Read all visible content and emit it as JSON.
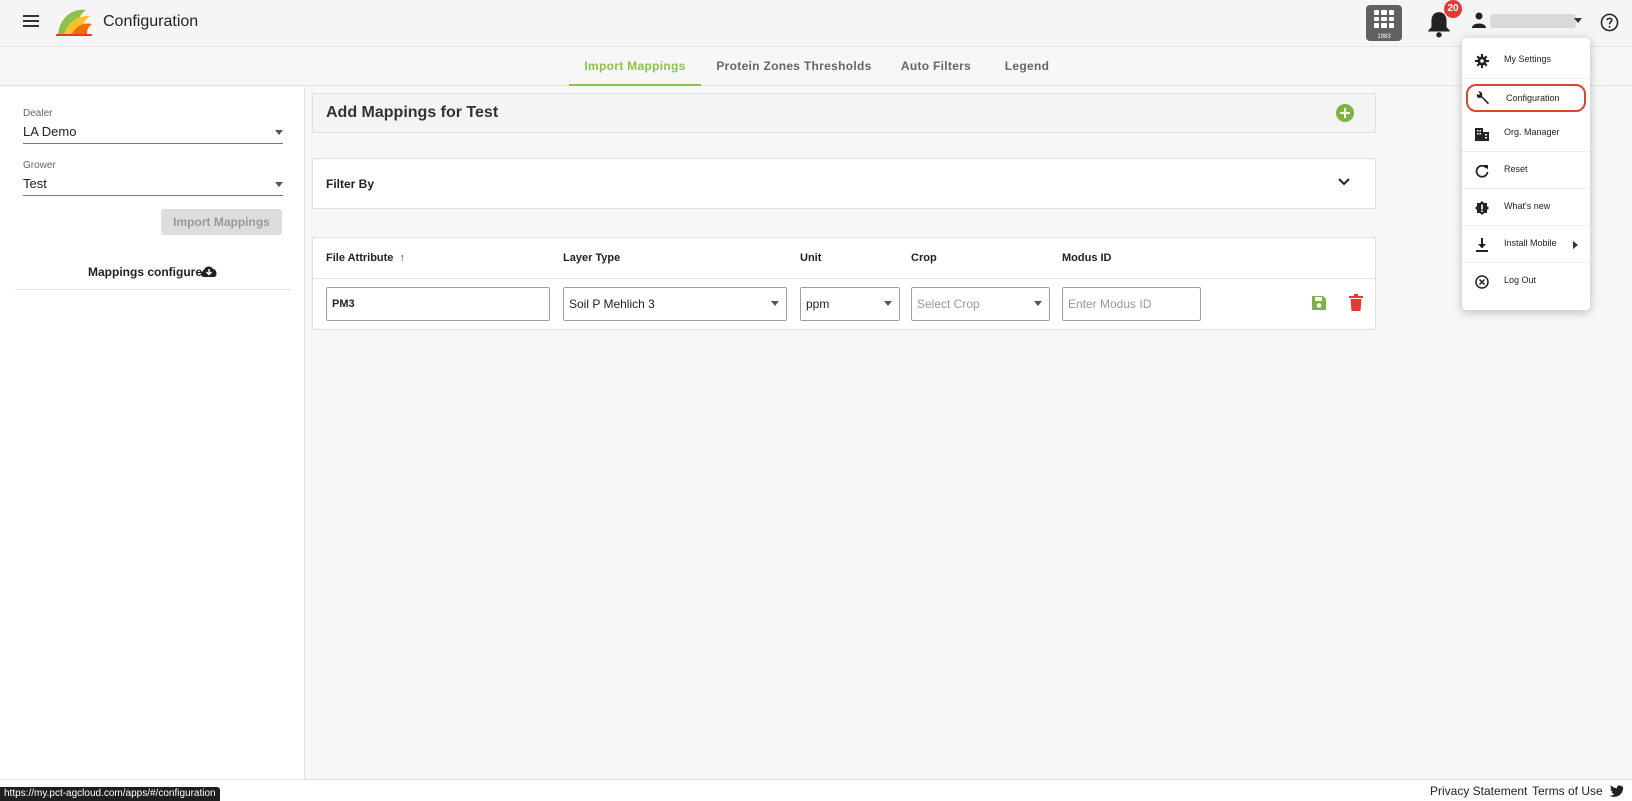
{
  "header": {
    "title": "Configuration",
    "apps_caption": "1983",
    "notification_count": "20"
  },
  "tabs": [
    {
      "label": "Import Mappings",
      "active": true
    },
    {
      "label": "Protein Zones Thresholds",
      "active": false
    },
    {
      "label": "Auto Filters",
      "active": false
    },
    {
      "label": "Legend",
      "active": false
    }
  ],
  "sidebar": {
    "dealer_label": "Dealer",
    "dealer_value": "LA Demo",
    "grower_label": "Grower",
    "grower_value": "Test",
    "import_button": "Import Mappings",
    "mappings_configured": "Mappings configured"
  },
  "main": {
    "add_title": "Add Mappings for Test",
    "filter_title": "Filter By",
    "columns": [
      "File Attribute",
      "Layer Type",
      "Unit",
      "Crop",
      "Modus ID"
    ],
    "sort_indicator": "↑",
    "row": {
      "file_attribute": "PM3",
      "layer_type": "Soil P Mehlich 3",
      "unit": "ppm",
      "crop_placeholder": "Select Crop",
      "modus_placeholder": "Enter Modus ID"
    }
  },
  "user_menu": {
    "items": [
      {
        "label": "My Settings",
        "icon": "gear-icon"
      },
      {
        "label": "Configuration",
        "icon": "wrench-icon",
        "highlighted": true
      },
      {
        "label": "Org. Manager",
        "icon": "building-icon"
      },
      {
        "label": "Reset",
        "icon": "refresh-icon"
      },
      {
        "label": "What's new",
        "icon": "new-badge-icon"
      },
      {
        "label": "Install Mobile",
        "icon": "download-icon"
      },
      {
        "label": "Log Out",
        "icon": "logout-icon"
      }
    ]
  },
  "footer": {
    "privacy": "Privacy Statement",
    "terms": "Terms of Use",
    "status_url": "https://my.pct-agcloud.com/apps/#/configuration"
  },
  "colors": {
    "accent": "#8bc34a",
    "add_green": "#7cb342",
    "delete_red": "#e53935",
    "highlight_ring": "#d84532"
  }
}
